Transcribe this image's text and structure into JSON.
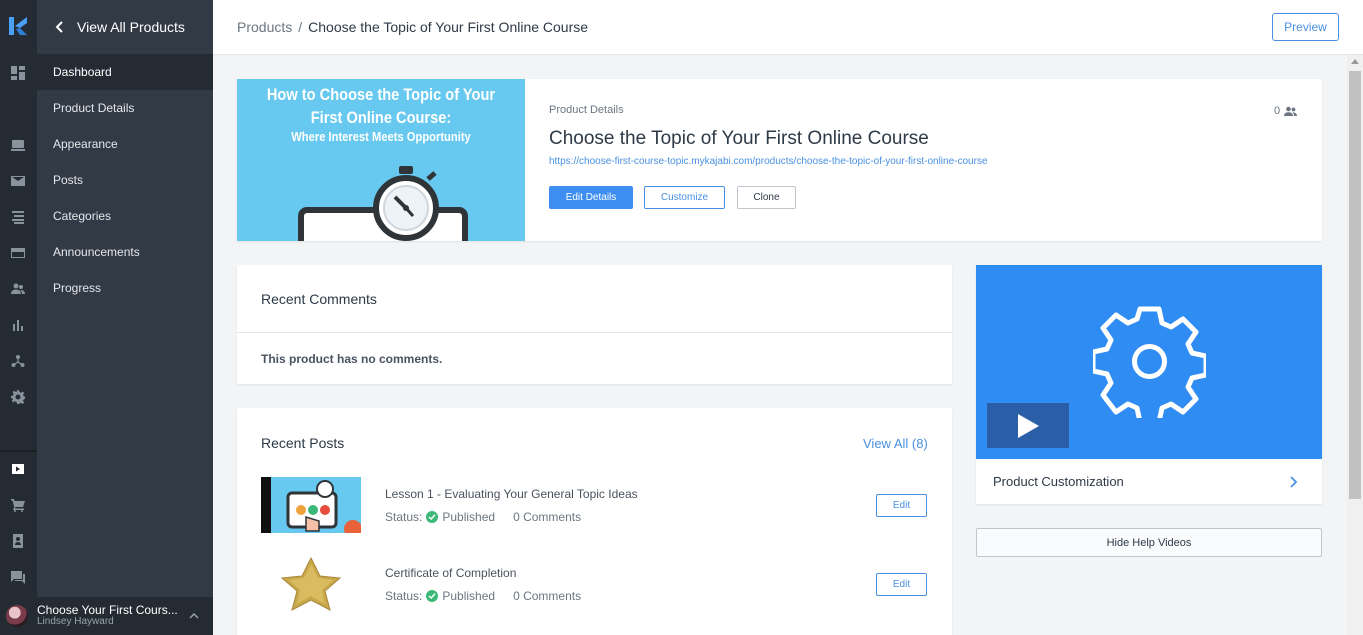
{
  "sidebar": {
    "back_label": "View All Products",
    "items": [
      {
        "label": "Dashboard",
        "active": true
      },
      {
        "label": "Product Details"
      },
      {
        "label": "Appearance"
      },
      {
        "label": "Posts"
      },
      {
        "label": "Categories"
      },
      {
        "label": "Announcements"
      },
      {
        "label": "Progress"
      }
    ],
    "account": {
      "site_name": "Choose Your First Cours...",
      "user_name": "Lindsey Hayward"
    }
  },
  "rail_icons": [
    "kajabi-logo-icon",
    "dashboard-icon",
    "website-icon",
    "email-icon",
    "pipelines-icon",
    "offers-icon",
    "people-icon",
    "analytics-icon",
    "automations-icon",
    "settings-icon",
    "products-icon",
    "cart-icon",
    "contacts-icon",
    "chat-icon"
  ],
  "header": {
    "breadcrumb_root": "Products",
    "breadcrumb_sep": "/",
    "breadcrumb_current": "Choose the Topic of Your First Online Course",
    "preview_label": "Preview"
  },
  "product": {
    "thumb_title": "How to Choose the Topic of Your First Online Course:",
    "thumb_subtitle": "Where Interest Meets Opportunity",
    "section_label": "Product Details",
    "title": "Choose the Topic of Your First Online Course",
    "url": "https://choose-first-course-topic.mykajabi.com/products/choose-the-topic-of-your-first-online-course",
    "edit_label": "Edit Details",
    "customize_label": "Customize",
    "clone_label": "Clone",
    "member_count": "0"
  },
  "comments": {
    "heading": "Recent Comments",
    "empty_text": "This product has no comments."
  },
  "posts": {
    "heading": "Recent Posts",
    "view_all": "View All (8)",
    "items": [
      {
        "title": "Lesson 1 - Evaluating Your General Topic Ideas",
        "status_label": "Status:",
        "status": "Published",
        "comments": "0 Comments",
        "edit": "Edit"
      },
      {
        "title": "Certificate of Completion",
        "status_label": "Status:",
        "status": "Published",
        "comments": "0 Comments",
        "edit": "Edit"
      }
    ]
  },
  "help": {
    "video_label": "Product Customization",
    "hide_label": "Hide Help Videos"
  },
  "colors": {
    "accent": "#3d8ef0",
    "sidebar": "#323a45",
    "rail": "#252b33",
    "published": "#3cb878",
    "video_bg": "#2f8cf2"
  }
}
